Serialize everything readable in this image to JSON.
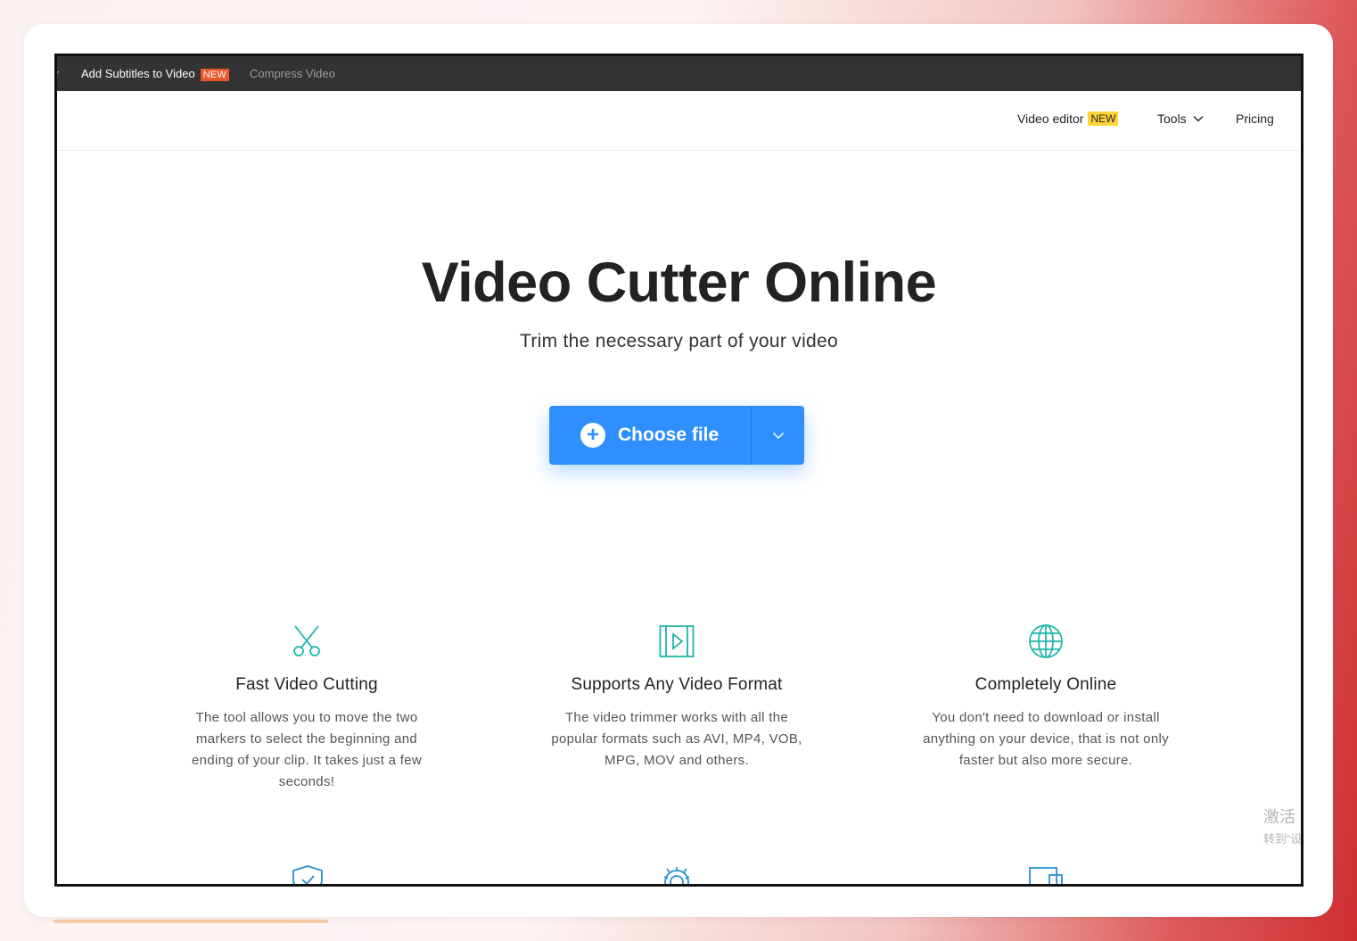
{
  "topbar": {
    "cut_text": "r",
    "active_item": "Add Subtitles to Video",
    "active_badge": "NEW",
    "muted_item": "Compress Video"
  },
  "nav": {
    "video_editor": "Video editor",
    "video_editor_badge": "NEW",
    "tools": "Tools",
    "pricing": "Pricing"
  },
  "hero": {
    "title": "Video Cutter Online",
    "subtitle": "Trim the necessary part of your video",
    "cta_label": "Choose file"
  },
  "features": [
    {
      "icon": "scissors-icon",
      "title": "Fast Video Cutting",
      "text": "The tool allows you to move the two markers to select the beginning and ending of your clip. It takes just a few seconds!"
    },
    {
      "icon": "video-frame-icon",
      "title": "Supports Any Video Format",
      "text": "The video trimmer works with all the popular formats such as AVI, MP4, VOB, MPG, MOV and others."
    },
    {
      "icon": "globe-icon",
      "title": "Completely Online",
      "text": "You don't need to download or install anything on your device, that is not only faster but also more secure."
    }
  ],
  "watermark": {
    "line1": "激活",
    "line2": "转到“设"
  },
  "colors": {
    "accent": "#2f8fff",
    "icon_teal": "#1fb5a8",
    "badge_red": "#e8572c",
    "badge_yellow": "#ffd43b",
    "topbar_bg": "#333333"
  }
}
